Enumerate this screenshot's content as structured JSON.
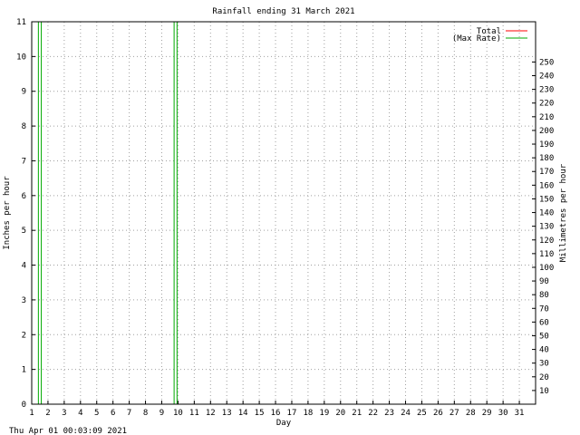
{
  "chart_data": {
    "type": "line",
    "title": "Rainfall ending 31 March 2021",
    "xlabel": "Day",
    "ylabel": "Inches per hour",
    "y2label": "Millimetres per hour",
    "timestamp": "Thu Apr 01 00:03:09 2021",
    "xlim": [
      1,
      32
    ],
    "ylim": [
      0,
      11
    ],
    "y2lim": [
      0,
      279.4
    ],
    "x_ticks": [
      "1",
      "2",
      "3",
      "4",
      "5",
      "6",
      "7",
      "8",
      "9",
      "10",
      "11",
      "12",
      "13",
      "14",
      "15",
      "16",
      "17",
      "18",
      "19",
      "20",
      "21",
      "22",
      "23",
      "24",
      "25",
      "26",
      "27",
      "28",
      "29",
      "30",
      "31"
    ],
    "y_ticks": [
      "0",
      "1",
      "2",
      "3",
      "4",
      "5",
      "6",
      "7",
      "8",
      "9",
      "10",
      "11"
    ],
    "y2_ticks": [
      "10",
      "20",
      "30",
      "40",
      "50",
      "60",
      "70",
      "80",
      "90",
      "100",
      "110",
      "120",
      "130",
      "140",
      "150",
      "160",
      "170",
      "180",
      "190",
      "200",
      "210",
      "220",
      "230",
      "240",
      "250"
    ],
    "grid": true,
    "legend_position": "top-right",
    "series": [
      {
        "name": "Total",
        "color": "#ff0000",
        "points": [
          [
            1,
            0
          ],
          [
            31.9,
            0
          ]
        ]
      },
      {
        "name": "(Max Rate)",
        "color": "#00aa00",
        "spikes": [
          {
            "x": 1.5,
            "width": 0.18,
            "value": 11
          },
          {
            "x": 9.85,
            "width": 0.18,
            "value": 11
          }
        ]
      }
    ]
  }
}
